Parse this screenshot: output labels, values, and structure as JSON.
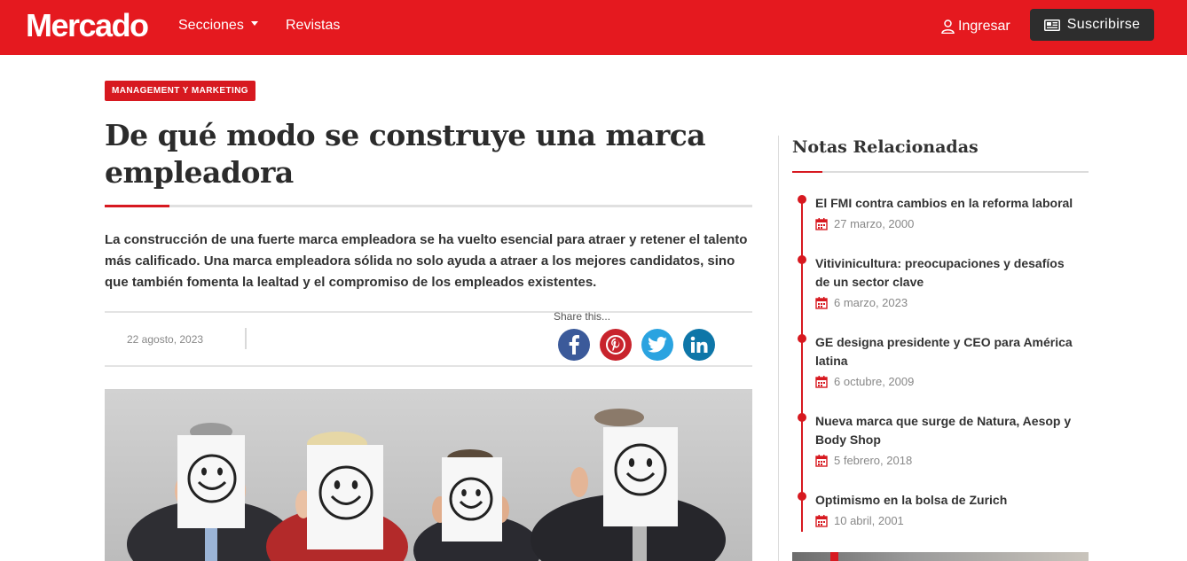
{
  "header": {
    "logo": "Mercado",
    "nav": {
      "secciones": "Secciones",
      "revistas": "Revistas"
    },
    "login": "Ingresar",
    "subscribe": "Suscribirse",
    "color": "#e5191f"
  },
  "article": {
    "category": "MANAGEMENT Y MARKETING",
    "title": "De qué modo se construye una marca empleadora",
    "lead": "La construcción de una fuerte marca empleadora se ha vuelto esencial para atraer y retener el talento más calificado. Una marca empleadora sólida no solo ayuda a atraer a los mejores candidatos, sino que también fomenta la lealtad y el compromiso de los empleados existentes.",
    "date": "22 agosto, 2023",
    "share_label": "Share this...",
    "share": [
      "facebook-icon",
      "pinterest-icon",
      "twitter-icon",
      "linkedin-icon"
    ]
  },
  "sidebar": {
    "title": "Notas Relacionadas",
    "items": [
      {
        "title": "El FMI contra cambios en la reforma laboral",
        "date": "27 marzo, 2000"
      },
      {
        "title": "Vitivinicultura: preocupaciones y desafíos de un sector clave",
        "date": "6 marzo, 2023"
      },
      {
        "title": "GE designa presidente y CEO para América latina",
        "date": "6 octubre, 2009"
      },
      {
        "title": "Nueva marca que surge de Natura, Aesop y Body Shop",
        "date": "5 febrero, 2018"
      },
      {
        "title": "Optimismo en la bolsa de Zurich",
        "date": "10 abril, 2001"
      }
    ]
  },
  "colors": {
    "brand": "#e5191f",
    "accent": "#d71920",
    "dark": "#2d2d2d"
  }
}
